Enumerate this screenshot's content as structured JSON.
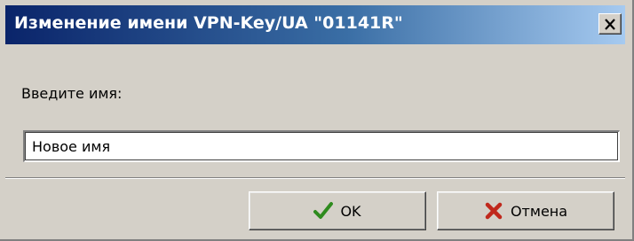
{
  "dialog": {
    "title": "Изменение имени VPN-Key/UA \"01141R\"",
    "close_glyph": "close-icon",
    "prompt_label": "Введите имя:",
    "name_value": "Новое имя",
    "ok_label": "OK",
    "ok_icon": "checkmark-icon",
    "cancel_label": "Отмена",
    "cancel_icon": "cross-icon"
  },
  "colors": {
    "titlebar_start": "#0a246a",
    "titlebar_end": "#a6caf0",
    "face": "#d4d0c8",
    "ok_check": "#2e8b1e",
    "cancel_cross": "#c0281c"
  }
}
